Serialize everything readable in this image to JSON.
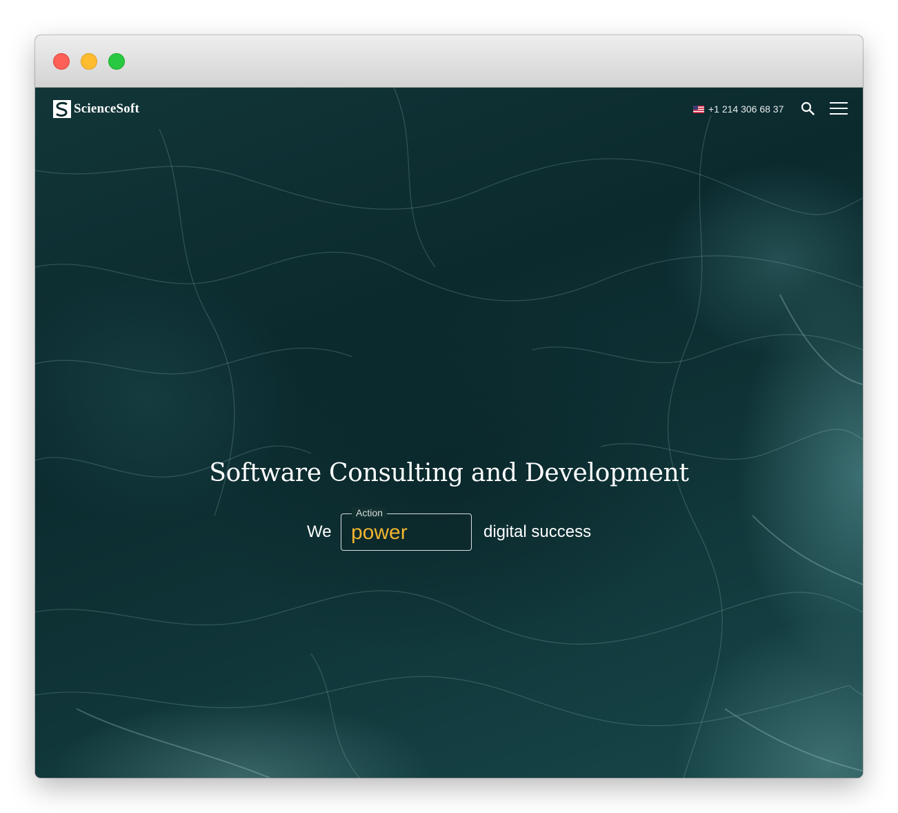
{
  "window": {
    "controls": [
      "close",
      "minimize",
      "maximize"
    ]
  },
  "header": {
    "logo_text": "ScienceSoft",
    "phone": "+1 214 306 68 37",
    "flag_icon": "us-flag-icon",
    "search_icon": "search-icon",
    "menu_icon": "hamburger-menu-icon"
  },
  "hero": {
    "title": "Software Consulting and Development",
    "tagline_prefix": "We",
    "action_label": "Action",
    "action_value": "power",
    "tagline_suffix": "digital success"
  },
  "colors": {
    "accent": "#f2b431",
    "text": "#ffffff",
    "background": "#0c2a2d"
  }
}
